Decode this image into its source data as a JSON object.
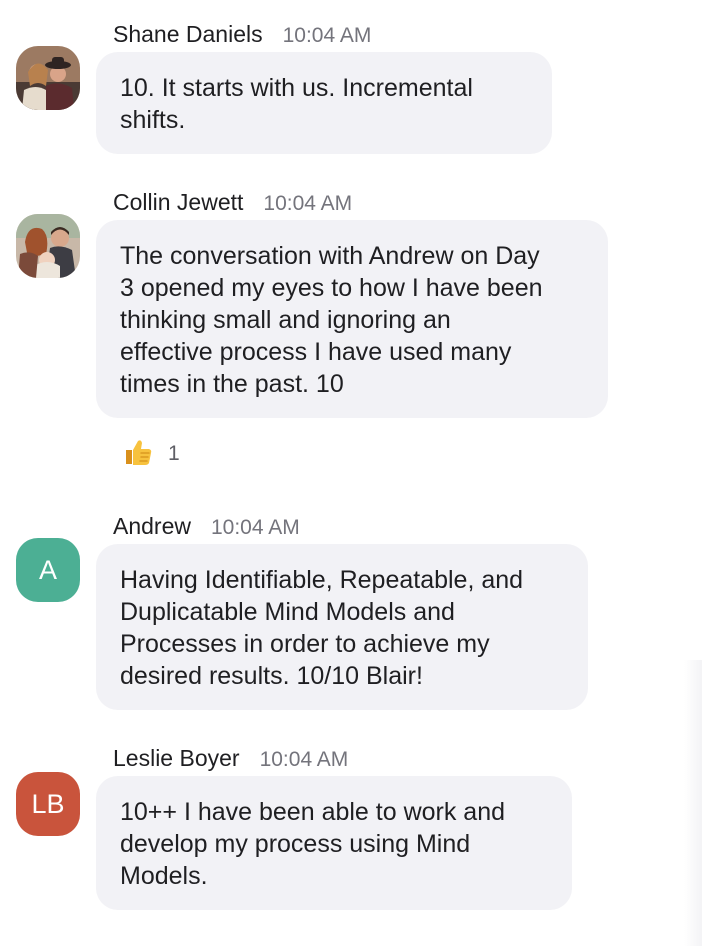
{
  "messages": [
    {
      "sender": "Shane Daniels",
      "time": "10:04 AM",
      "avatar_type": "photo",
      "text": "10.  It starts with us.  Incremental\nshifts."
    },
    {
      "sender": "Collin Jewett",
      "time": "10:04 AM",
      "avatar_type": "photo",
      "text": "The conversation with Andrew on Day\n3 opened my eyes to how I have been\nthinking small and ignoring an\neffective process I have used many\ntimes in the past. 10",
      "reaction": {
        "icon": "thumbs-up-icon",
        "count": "1"
      }
    },
    {
      "sender": "Andrew",
      "time": "10:04 AM",
      "avatar_type": "initials",
      "avatar_initials": "A",
      "avatar_color": "#4caf94",
      "text": "Having Identifiable, Repeatable, and\nDuplicatable Mind Models and\nProcesses in order to achieve my\ndesired results. 10/10 Blair!"
    },
    {
      "sender": "Leslie Boyer",
      "time": "10:04 AM",
      "avatar_type": "initials",
      "avatar_initials": "LB",
      "avatar_color": "#c9543c",
      "text": "10++  I have been able to work and\ndevelop my process using Mind\nModels."
    }
  ]
}
